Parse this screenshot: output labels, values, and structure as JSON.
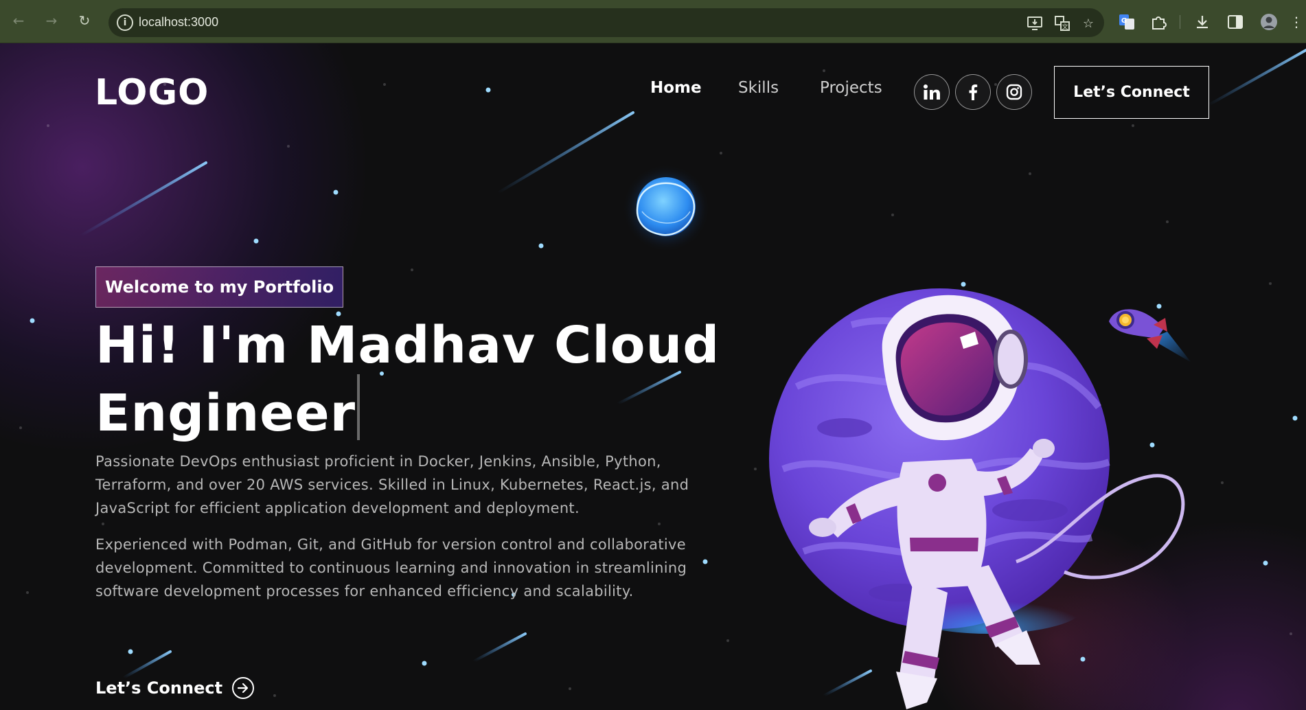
{
  "browser": {
    "url": "localhost:3000",
    "icons": [
      "back-icon",
      "forward-icon",
      "reload-icon",
      "site-info-icon",
      "install-app-icon",
      "translate-icon",
      "bookmark-star-icon",
      "google-translate-extension-icon",
      "extensions-icon",
      "download-icon",
      "side-panel-icon",
      "profile-avatar"
    ]
  },
  "header": {
    "logo": "LOGO",
    "nav": [
      {
        "label": "Home",
        "active": true
      },
      {
        "label": "Skills",
        "active": false
      },
      {
        "label": "Projects",
        "active": false
      }
    ],
    "socials": [
      "linkedin-icon",
      "facebook-icon",
      "instagram-icon"
    ],
    "cta_label": "Let’s Connect"
  },
  "hero": {
    "tagline": "Welcome to my Portfolio",
    "headline_line1": "Hi! I'm Madhav Cloud",
    "headline_line2": "Engineer",
    "paragraph1": "Passionate DevOps enthusiast proficient in Docker, Jenkins, Ansible, Python, Terraform, and over 20 AWS services. Skilled in Linux, Kubernetes, React.js, and JavaScript for efficient application development and deployment.",
    "paragraph2": "Experienced with Podman, Git, and GitHub for version control and collaborative development. Committed to continuous learning and innovation in streamlining software development processes for enhanced efficiency and scalability.",
    "link_label": "Let’s Connect"
  },
  "colors": {
    "tagline_gradient_start": "#aa367c",
    "tagline_gradient_end": "#4a2fbd",
    "background": "#0f0f10",
    "planet": "#6a45d8"
  }
}
